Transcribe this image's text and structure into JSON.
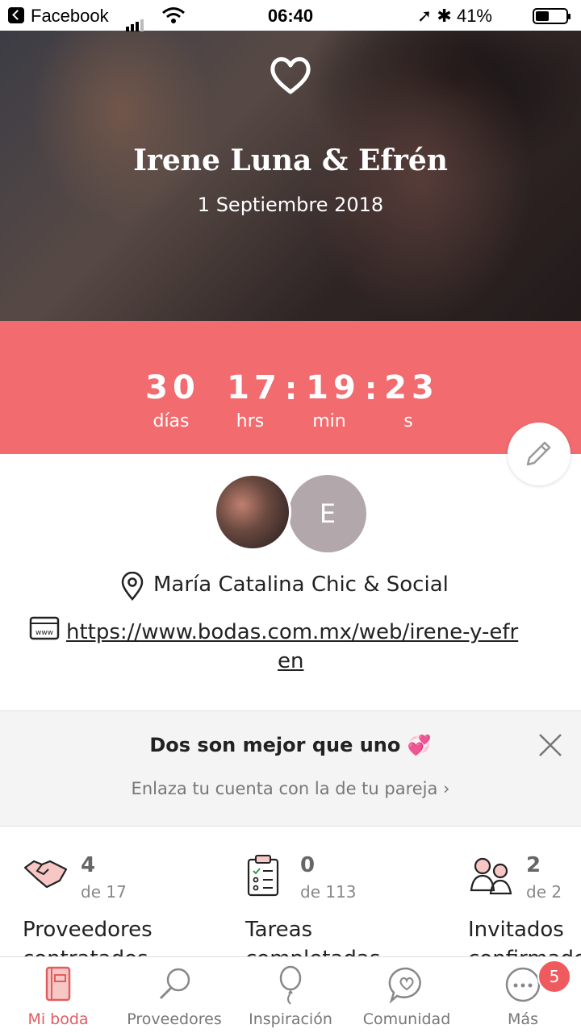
{
  "status_bar": {
    "back_app": "Facebook",
    "time": "06:40",
    "battery": "41%",
    "battery_level": 0.41
  },
  "hero": {
    "names": "Irene Luna & Efrén",
    "date": "1 Septiembre 2018"
  },
  "countdown": {
    "days": "30",
    "hours": "17",
    "minutes": "19",
    "seconds": "23",
    "days_label": "días",
    "hours_label": "hrs",
    "minutes_label": "min",
    "seconds_label": "s"
  },
  "couple": {
    "avatar2_initial": "E",
    "venue": "María Catalina Chic & Social",
    "url_line1": "https://www.bodas.com.mx/web/irene-y-efr",
    "url_line2": "en"
  },
  "promo": {
    "title": "Dos son mejor que uno 💞",
    "subtitle": "Enlaza tu cuenta con la de tu pareja  ›"
  },
  "stats": [
    {
      "count": "4",
      "of": "de 17",
      "label": "Proveedores",
      "label2": "contratados",
      "icon": "handshake-icon"
    },
    {
      "count": "0",
      "of": "de 113",
      "label": "Tareas",
      "label2": "completadas",
      "icon": "checklist-icon"
    },
    {
      "count": "2",
      "of": "de 2",
      "label": "Invitados",
      "label2": "confirmados",
      "icon": "guests-icon"
    }
  ],
  "tabs": [
    {
      "label": "Mi boda",
      "icon": "notebook-icon",
      "active": true
    },
    {
      "label": "Proveedores",
      "icon": "search-icon"
    },
    {
      "label": "Inspiración",
      "icon": "balloon-icon"
    },
    {
      "label": "Comunidad",
      "icon": "chat-heart-icon"
    },
    {
      "label": "Más",
      "icon": "more-icon"
    }
  ],
  "more_badge": "5",
  "colors": {
    "accent": "#f26b6e",
    "accent_text": "#e35c60",
    "badge": "#ef5a5e"
  }
}
